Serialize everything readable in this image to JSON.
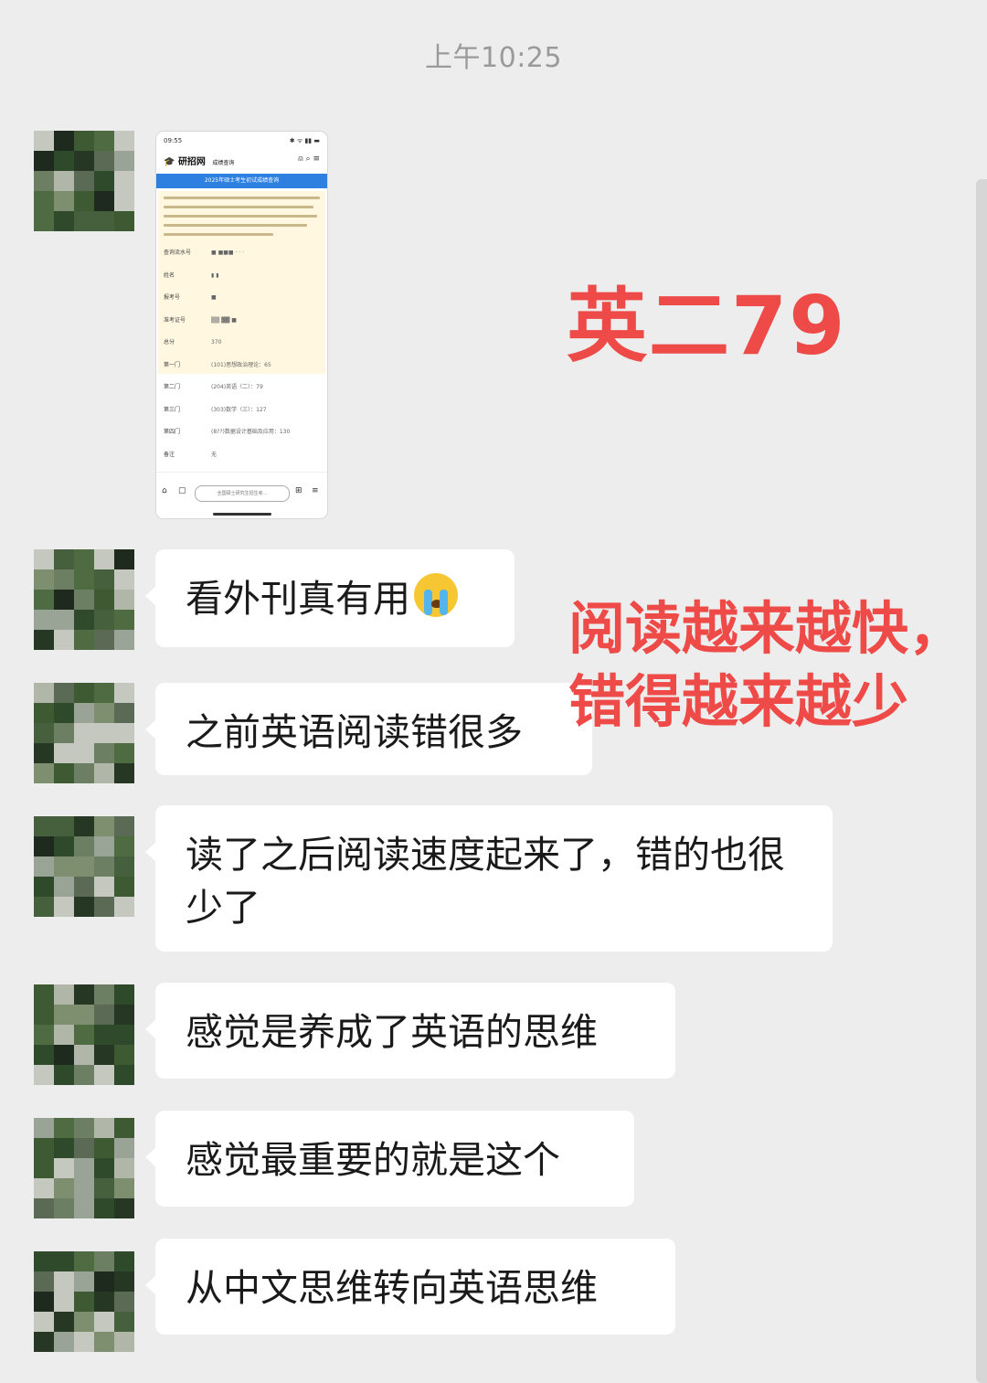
{
  "chat": {
    "timestamp": "上午10:25",
    "screenshot": {
      "status_time": "09:55",
      "site_name": "研招网",
      "site_sub": "成绩查询",
      "banner": "2025年硕士考生初试成绩查询",
      "fields": [
        {
          "label": "查询流水号",
          "value": "■ ■■■ · · ·"
        },
        {
          "label": "姓名",
          "value": "▮ ▮"
        },
        {
          "label": "报考号",
          "value": "■"
        },
        {
          "label": "准考证号",
          "value": "▒▒ ▓▓ ■"
        },
        {
          "label": "总分",
          "value": "370"
        },
        {
          "label": "第一门",
          "value": "(101)思想政治理论：65"
        },
        {
          "label": "第二门",
          "value": "(204)英语（二）：79"
        },
        {
          "label": "第三门",
          "value": "(303)数学（三）：127"
        },
        {
          "label": "第四门",
          "value": "(8??)数据设计基础及应用：130"
        },
        {
          "label": "备注",
          "value": "无"
        }
      ],
      "address_bar": "全国硕士研究生招生考..."
    },
    "messages": [
      {
        "text": "看外刊真有用",
        "emoji": "crying-face"
      },
      {
        "text": "之前英语阅读错很多"
      },
      {
        "text": "读了之后阅读速度起来了，错的也很少了"
      },
      {
        "text": "感觉是养成了英语的思维"
      },
      {
        "text": "感觉最重要的就是这个"
      },
      {
        "text": "从中文思维转向英语思维"
      }
    ]
  },
  "overlay": {
    "score": "英二79",
    "note_line1": "阅读越来越快，",
    "note_line2": "错得越来越少",
    "color": "#ee4a48"
  },
  "colors": {
    "background": "#ededed",
    "bubble": "#ffffff",
    "timestamp": "#9a9a9a"
  }
}
